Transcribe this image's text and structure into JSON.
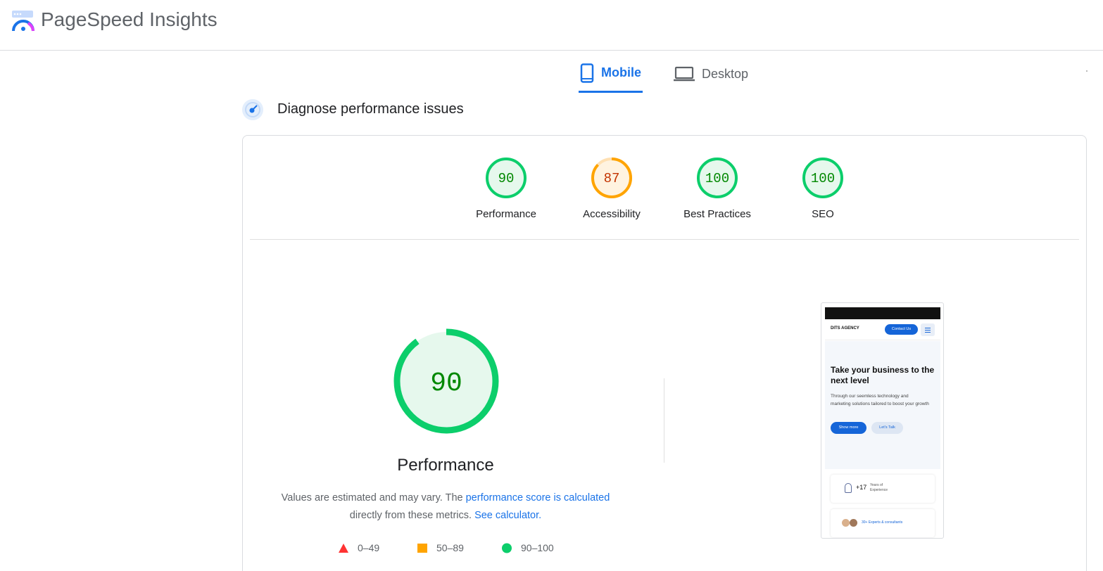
{
  "app": {
    "title": "PageSpeed Insights"
  },
  "tabs": [
    {
      "label": "Mobile",
      "icon": "smartphone-icon",
      "selected": true
    },
    {
      "label": "Desktop",
      "icon": "laptop-icon",
      "selected": false
    }
  ],
  "section": {
    "title": "Diagnose performance issues",
    "icon": "gauge-icon"
  },
  "scores": [
    {
      "label": "Performance",
      "value": "90",
      "status": "pass"
    },
    {
      "label": "Accessibility",
      "value": "87",
      "status": "average"
    },
    {
      "label": "Best Practices",
      "value": "100",
      "status": "pass"
    },
    {
      "label": "SEO",
      "value": "100",
      "status": "pass"
    }
  ],
  "main_score": {
    "value": "90",
    "label": "Performance"
  },
  "description": {
    "text1": "Values are estimated and may vary. The ",
    "link1": "performance score is calculated",
    "text2": "directly from these metrics. ",
    "link2": "See calculator."
  },
  "legend": [
    {
      "range": "0–49",
      "shape": "triangle",
      "color": "#ff3333"
    },
    {
      "range": "50–89",
      "shape": "square",
      "color": "#ffa400"
    },
    {
      "range": "90–100",
      "shape": "circle",
      "color": "#0cce6b"
    }
  ],
  "colors": {
    "pass": "#0cce6b",
    "pass_text": "#008800",
    "pass_bg": "#e6f8ed",
    "average": "#ffa400",
    "average_text": "#c33300",
    "average_bg": "#fff3e0",
    "accent": "#1a73e8"
  },
  "screenshot": {
    "brand": "DITS AGENCY",
    "contact_button": "Contact Us",
    "headline": "Take your business to the next level",
    "paragraph": "Through our seemless technology and marketing solutions tailored to boost your growth",
    "primary_button": "Show more",
    "secondary_button": "Let's Talk",
    "stat_number": "+17",
    "stat_text": "Years of Experience",
    "experts_text": "30+ Experts & consultants"
  }
}
